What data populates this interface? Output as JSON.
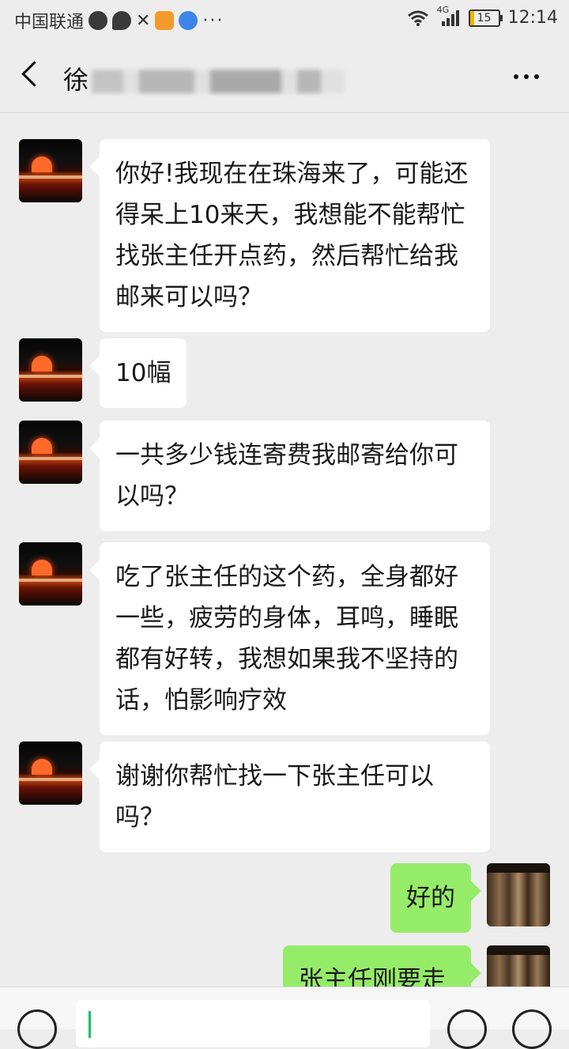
{
  "status_bar": {
    "carrier": "中国联通",
    "network": "4G",
    "battery": "15",
    "battery_level": 0.15,
    "time": "12:14",
    "more_dots": "···"
  },
  "header": {
    "title": "徐",
    "title_rest_blurred": true
  },
  "messages": [
    {
      "side": "left",
      "text": "你好!我现在在珠海来了，可能还得呆上10来天，我想能不能帮忙找张主任开点药，然后帮忙给我邮来可以吗？"
    },
    {
      "side": "left",
      "text": "10幅"
    },
    {
      "side": "left",
      "text": "一共多少钱连寄费我邮寄给你可以吗？"
    },
    {
      "side": "left",
      "text": "吃了张主任的这个药，全身都好一些，疲劳的身体，耳鸣，睡眠都有好转，我想如果我不坚持的话，怕影响疗效"
    },
    {
      "side": "left",
      "text": "谢谢你帮忙找一下张主任可以吗？"
    },
    {
      "side": "right",
      "text": "好的"
    },
    {
      "side": "right",
      "text": "张主任刚要走"
    }
  ],
  "colors": {
    "background": "#ededed",
    "bubble_incoming": "#ffffff",
    "bubble_outgoing": "#95ec69",
    "cursor": "#07c160"
  },
  "icons": [
    "back-icon",
    "more-icon",
    "voice-icon",
    "emoji-icon",
    "plus-icon",
    "wifi-icon",
    "signal-icon",
    "battery-icon"
  ]
}
